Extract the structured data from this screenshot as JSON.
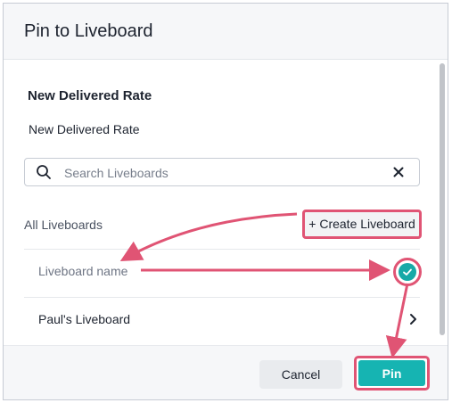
{
  "dialog": {
    "title": "Pin to Liveboard",
    "section_title": "New Delivered Rate",
    "visualization_name": "New Delivered Rate",
    "search": {
      "placeholder": "Search Liveboards",
      "value": ""
    },
    "list_heading": "All Liveboards",
    "create_button_label": "+ Create Liveboard",
    "items": [
      {
        "label": "Liveboard name",
        "selected": true
      },
      {
        "label": "Paul's Liveboard",
        "selected": false
      }
    ],
    "cancel_label": "Cancel",
    "pin_label": "Pin"
  },
  "icons": {
    "search": "search-icon",
    "clear": "close-icon",
    "selected": "check-icon",
    "expand": "chevron-right-icon"
  },
  "colors": {
    "accent": "#16b4b2",
    "highlight": "#e05474",
    "text": "#1d232f",
    "muted": "#6e7584"
  }
}
